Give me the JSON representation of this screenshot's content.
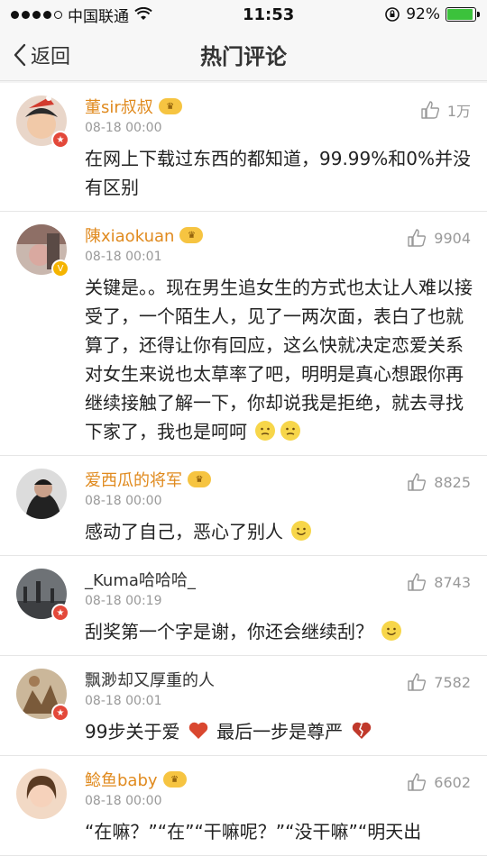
{
  "status_bar": {
    "carrier": "中国联通",
    "time": "11:53",
    "battery": "92%",
    "battery_level": 0.92,
    "icons": [
      "signal-dots-icon",
      "wifi-icon",
      "orientation-lock-icon",
      "battery-icon"
    ]
  },
  "nav": {
    "back_label": "返回",
    "title": "热门评论"
  },
  "colors": {
    "accent_name": "#e08a1e",
    "badge_red": "#e3483a",
    "badge_yellow": "#f5b400",
    "battery_green": "#3cc23c"
  },
  "comments": [
    {
      "name": "董sir叔叔",
      "time": "08-18 00:00",
      "likes": "1万",
      "text": "在网上下载过东西的都知道，99.99%和0%并没有区别"
    },
    {
      "name": "陳xiaokuan",
      "time": "08-18 00:01",
      "likes": "9904",
      "text": "关键是。。现在男生追女生的方式也太让人难以接受了，一个陌生人，见了一两次面，表白了也就算了，还得让你有回应，这么快就决定恋爱关系对女生来说也太草率了吧，明明是真心想跟你再继续接触了解一下，你却说我是拒绝，就去寻找下家了，我也是呵呵"
    },
    {
      "name": "爱西瓜的将军",
      "time": "08-18 00:00",
      "likes": "8825",
      "text": "感动了自己，恶心了别人"
    },
    {
      "name": "_Kuma哈哈哈_",
      "time": "08-18 00:19",
      "likes": "8743",
      "text": "刮奖第一个字是谢，你还会继续刮？"
    },
    {
      "name": "飘渺却又厚重的人",
      "time": "08-18 00:01",
      "likes": "7582",
      "text_part1": "99步关于爱",
      "text_part2": "最后一步是尊严"
    },
    {
      "name": "鲶鱼baby",
      "time": "08-18 00:00",
      "likes": "6602",
      "text": "“在嘛？”“在”“干嘛呢？”“没干嘛”“明天出"
    }
  ]
}
